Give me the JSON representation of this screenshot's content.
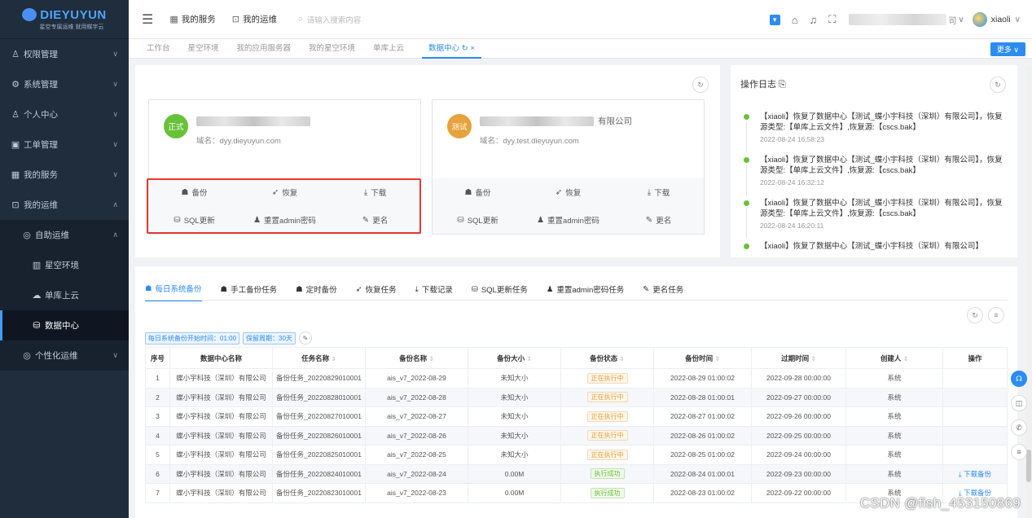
{
  "sidebar": {
    "logo_text": "DIEYUYUN",
    "logo_sub": "星空专属运维 就用蝶宇云",
    "items": [
      {
        "label": "权限管理"
      },
      {
        "label": "系统管理"
      },
      {
        "label": "个人中心"
      },
      {
        "label": "工单管理"
      },
      {
        "label": "我的服务"
      },
      {
        "label": "我的运维"
      },
      {
        "label": "自助运维"
      },
      {
        "label": "星空环境"
      },
      {
        "label": "单库上云"
      },
      {
        "label": "数据中心"
      },
      {
        "label": "个性化运维"
      }
    ]
  },
  "topbar": {
    "my_services": "我的服务",
    "my_ops": "我的运维",
    "search_placeholder": "请输入搜索内容",
    "company_suffix": "司",
    "username": "xiaoli"
  },
  "tabs": [
    {
      "label": "工作台"
    },
    {
      "label": "星空环境"
    },
    {
      "label": "我的应用服务器"
    },
    {
      "label": "我的星空环境"
    },
    {
      "label": "单库上云"
    },
    {
      "label": "数据中心 ↻ ×"
    }
  ],
  "more_button": "更多 ∨",
  "cards": [
    {
      "badge": "正式",
      "domain": "域名：dyy.dieyuyun.com",
      "name_suffix": ""
    },
    {
      "badge": "测试",
      "domain": "域名：dyy.test.dieyuyun.com",
      "name_suffix": "有限公司"
    }
  ],
  "card_actions": {
    "backup": "备份",
    "restore": "恢复",
    "download": "下载",
    "sql_update": "SQL更新",
    "reset_admin": "重置admin密码",
    "rename": "更名"
  },
  "log": {
    "title": "操作日志",
    "entries": [
      {
        "text": "【xiaoli】恢复了数据中心【测试_蝶小宇科技（深圳）有限公司】，恢复源类型:【单库上云文件】,恢复源:【cscs.bak】",
        "time": "2022-08-24 16:58:23"
      },
      {
        "text": "【xiaoli】恢复了数据中心【测试_蝶小宇科技（深圳）有限公司】，恢复源类型:【单库上云文件】,恢复源:【cscs.bak】",
        "time": "2022-08-24 16:32:12"
      },
      {
        "text": "【xiaoli】恢复了数据中心【测试_蝶小宇科技（深圳）有限公司】，恢复源类型:【单库上云文件】,恢复源:【cscs.bak】",
        "time": "2022-08-24 16:20:11"
      },
      {
        "text": "【xiaoli】恢复了数据中心【测试_蝶小宇科技（深圳）有限公司】",
        "time": ""
      }
    ]
  },
  "subtabs": [
    {
      "label": "每日系统备份"
    },
    {
      "label": "手工备份任务"
    },
    {
      "label": "定时备份"
    },
    {
      "label": "恢复任务"
    },
    {
      "label": "下载记录"
    },
    {
      "label": "SQL更新任务"
    },
    {
      "label": "重置admin密码任务"
    },
    {
      "label": "更名任务"
    }
  ],
  "tags": {
    "start_time": "每日系统备份开始时间：01:00",
    "retention": "保留周期：30天"
  },
  "table": {
    "headers": [
      "序号",
      "数据中心名称",
      "任务名称",
      "备份名称",
      "备份大小",
      "备份状态",
      "备份时间",
      "过期时间",
      "创建人",
      "操作"
    ],
    "rows": [
      {
        "no": "1",
        "dc": "蝶小宇科技（深圳）有限公司",
        "task": "备份任务_20220829010001",
        "backup": "ais_v7_2022-08-29",
        "size": "未知大小",
        "status": "正在执行中",
        "status_type": "run",
        "time": "2022-08-29 01:00:02",
        "expire": "2022-09-28 00:00:00",
        "creator": "系统",
        "op": ""
      },
      {
        "no": "2",
        "dc": "蝶小宇科技（深圳）有限公司",
        "task": "备份任务_20220828010001",
        "backup": "ais_v7_2022-08-28",
        "size": "未知大小",
        "status": "正在执行中",
        "status_type": "run",
        "time": "2022-08-28 01:00:01",
        "expire": "2022-09-27 00:00:00",
        "creator": "系统",
        "op": ""
      },
      {
        "no": "3",
        "dc": "蝶小宇科技（深圳）有限公司",
        "task": "备份任务_20220827010001",
        "backup": "ais_v7_2022-08-27",
        "size": "未知大小",
        "status": "正在执行中",
        "status_type": "run",
        "time": "2022-08-27 01:00:02",
        "expire": "2022-09-26 00:00:00",
        "creator": "系统",
        "op": ""
      },
      {
        "no": "4",
        "dc": "蝶小宇科技（深圳）有限公司",
        "task": "备份任务_20220826010001",
        "backup": "ais_v7_2022-08-26",
        "size": "未知大小",
        "status": "正在执行中",
        "status_type": "run",
        "time": "2022-08-26 01:00:02",
        "expire": "2022-09-25 00:00:00",
        "creator": "系统",
        "op": ""
      },
      {
        "no": "5",
        "dc": "蝶小宇科技（深圳）有限公司",
        "task": "备份任务_20220825010001",
        "backup": "ais_v7_2022-08-25",
        "size": "未知大小",
        "status": "正在执行中",
        "status_type": "run",
        "time": "2022-08-25 01:00:02",
        "expire": "2022-09-24 00:00:00",
        "creator": "系统",
        "op": ""
      },
      {
        "no": "6",
        "dc": "蝶小宇科技（深圳）有限公司",
        "task": "备份任务_20220824010001",
        "backup": "ais_v7_2022-08-24",
        "size": "0.00M",
        "status": "执行成功",
        "status_type": "ok",
        "time": "2022-08-24 01:00:01",
        "expire": "2022-09-23 00:00:00",
        "creator": "系统",
        "op": "下载备份"
      },
      {
        "no": "7",
        "dc": "蝶小宇科技（深圳）有限公司",
        "task": "备份任务_20220823010001",
        "backup": "ais_v7_2022-08-23",
        "size": "0.00M",
        "status": "执行成功",
        "status_type": "ok",
        "time": "2022-08-23 01:00:02",
        "expire": "2022-09-22 00:00:00",
        "creator": "系统",
        "op": "下载备份"
      }
    ]
  },
  "watermark": "CSDN @fish_453150869"
}
